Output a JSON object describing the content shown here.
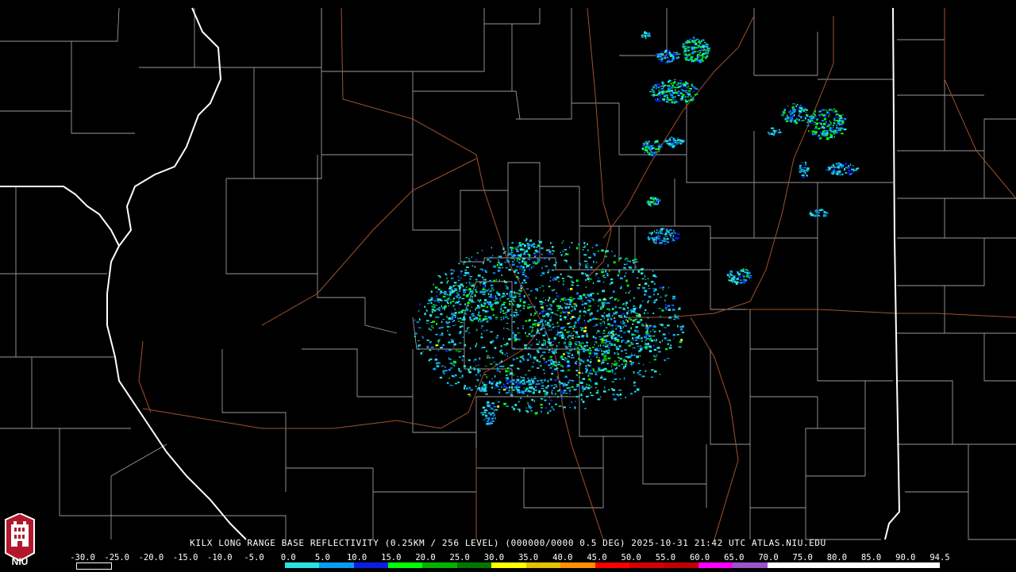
{
  "caption": "KILX LONG RANGE BASE REFLECTIVITY (0.25KM / 256 LEVEL) (000000/0000 0.5 DEG) 2025-10-31 21:42 UTC  ATLAS.NIU.EDU",
  "scale": {
    "labels": [
      "-30.0",
      "-25.0",
      "-20.0",
      "-15.0",
      "-10.0",
      "-5.0",
      "0.0",
      "5.0",
      "10.0",
      "15.0",
      "20.0",
      "25.0",
      "30.0",
      "35.0",
      "40.0",
      "45.0",
      "50.0",
      "55.0",
      "60.0",
      "65.0",
      "70.0",
      "75.0",
      "80.0",
      "85.0",
      "90.0",
      "94.5"
    ],
    "colors": [
      "#000000",
      "#000000",
      "#000000",
      "#000000",
      "#000000",
      "#000000",
      "#29e3e3",
      "#0a9cf0",
      "#0a1fe6",
      "#00ff00",
      "#00b400",
      "#007800",
      "#ffff00",
      "#e7c000",
      "#ff9000",
      "#ff0000",
      "#d60000",
      "#c00000",
      "#ff00ff",
      "#9955c9",
      "#ffffff",
      "#ffffff",
      "#ffffff",
      "#ffffff",
      "#ffffff"
    ]
  },
  "logo": {
    "text": "NIU",
    "color": "#b2182b"
  },
  "map": {
    "boundary_color": "#9a9a9a",
    "state_border_color": "#ffffff",
    "highway_color": "#a0522d",
    "radar_palette": [
      "#29e3e3",
      "#0a9cf0",
      "#0a1fe6",
      "#00ff00",
      "#00b400",
      "#ffff00"
    ]
  }
}
